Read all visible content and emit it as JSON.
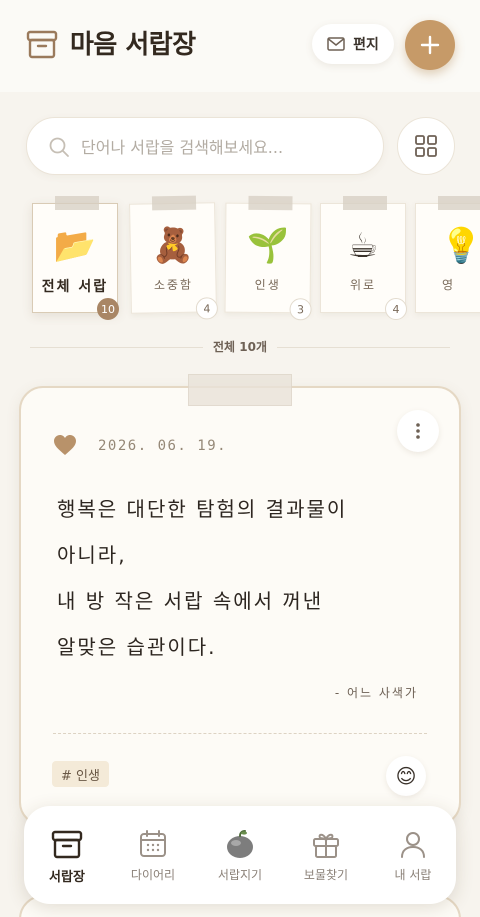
{
  "header": {
    "title": "마음 서랍장",
    "letter_label": "편지",
    "add_label": "+"
  },
  "search": {
    "placeholder": "단어나 서랍을 검색해보세요..."
  },
  "drawers": [
    {
      "label": "전체 서랍",
      "emoji": "📂",
      "count": "10",
      "active": true
    },
    {
      "label": "소중함",
      "emoji": "🧸",
      "count": "4"
    },
    {
      "label": "인생",
      "emoji": "🌱",
      "count": "3"
    },
    {
      "label": "위로",
      "emoji": "☕",
      "count": "4"
    },
    {
      "label": "영",
      "emoji": "💡",
      "count": ""
    }
  ],
  "total_label": "전체 10개",
  "card": {
    "date": "2026. 06. 19.",
    "quote_lines": [
      "행복은 대단한 탐험의 결과물이",
      "아니라,",
      "내 방 작은 서랍 속에서 꺼낸",
      "알맞은 습관이다."
    ],
    "author": "- 어느 사색가",
    "tag": "# 인생",
    "reaction": "😊",
    "liked": true
  },
  "nav": [
    {
      "label": "서랍장",
      "icon": "drawer-icon",
      "active": true
    },
    {
      "label": "다이어리",
      "icon": "calendar-icon"
    },
    {
      "label": "서랍지기",
      "icon": "pet-icon"
    },
    {
      "label": "보물찾기",
      "icon": "gift-icon"
    },
    {
      "label": "내 서랍",
      "icon": "profile-icon"
    }
  ],
  "colors": {
    "accent": "#c69a68",
    "background": "#f7f4ee",
    "text": "#33291f",
    "heart": "#b8926a"
  }
}
